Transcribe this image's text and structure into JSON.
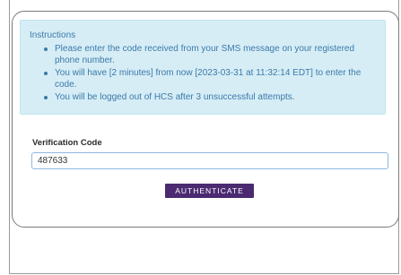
{
  "instructions": {
    "title": "Instructions",
    "items": [
      "Please enter the code received from your SMS message on your registered phone number.",
      "You will have [2 minutes] from now [2023-03-31 at 11:32:14 EDT] to enter the code.",
      "You will be logged out of HCS after 3 unsuccessful attempts."
    ]
  },
  "form": {
    "label": "Verification Code",
    "code_value": "487633",
    "button_label": "AUTHENTICATE"
  },
  "colors": {
    "button_background": "#4b2a70",
    "instructions_background": "#d6edf6",
    "instructions_text": "#3b79a8"
  }
}
